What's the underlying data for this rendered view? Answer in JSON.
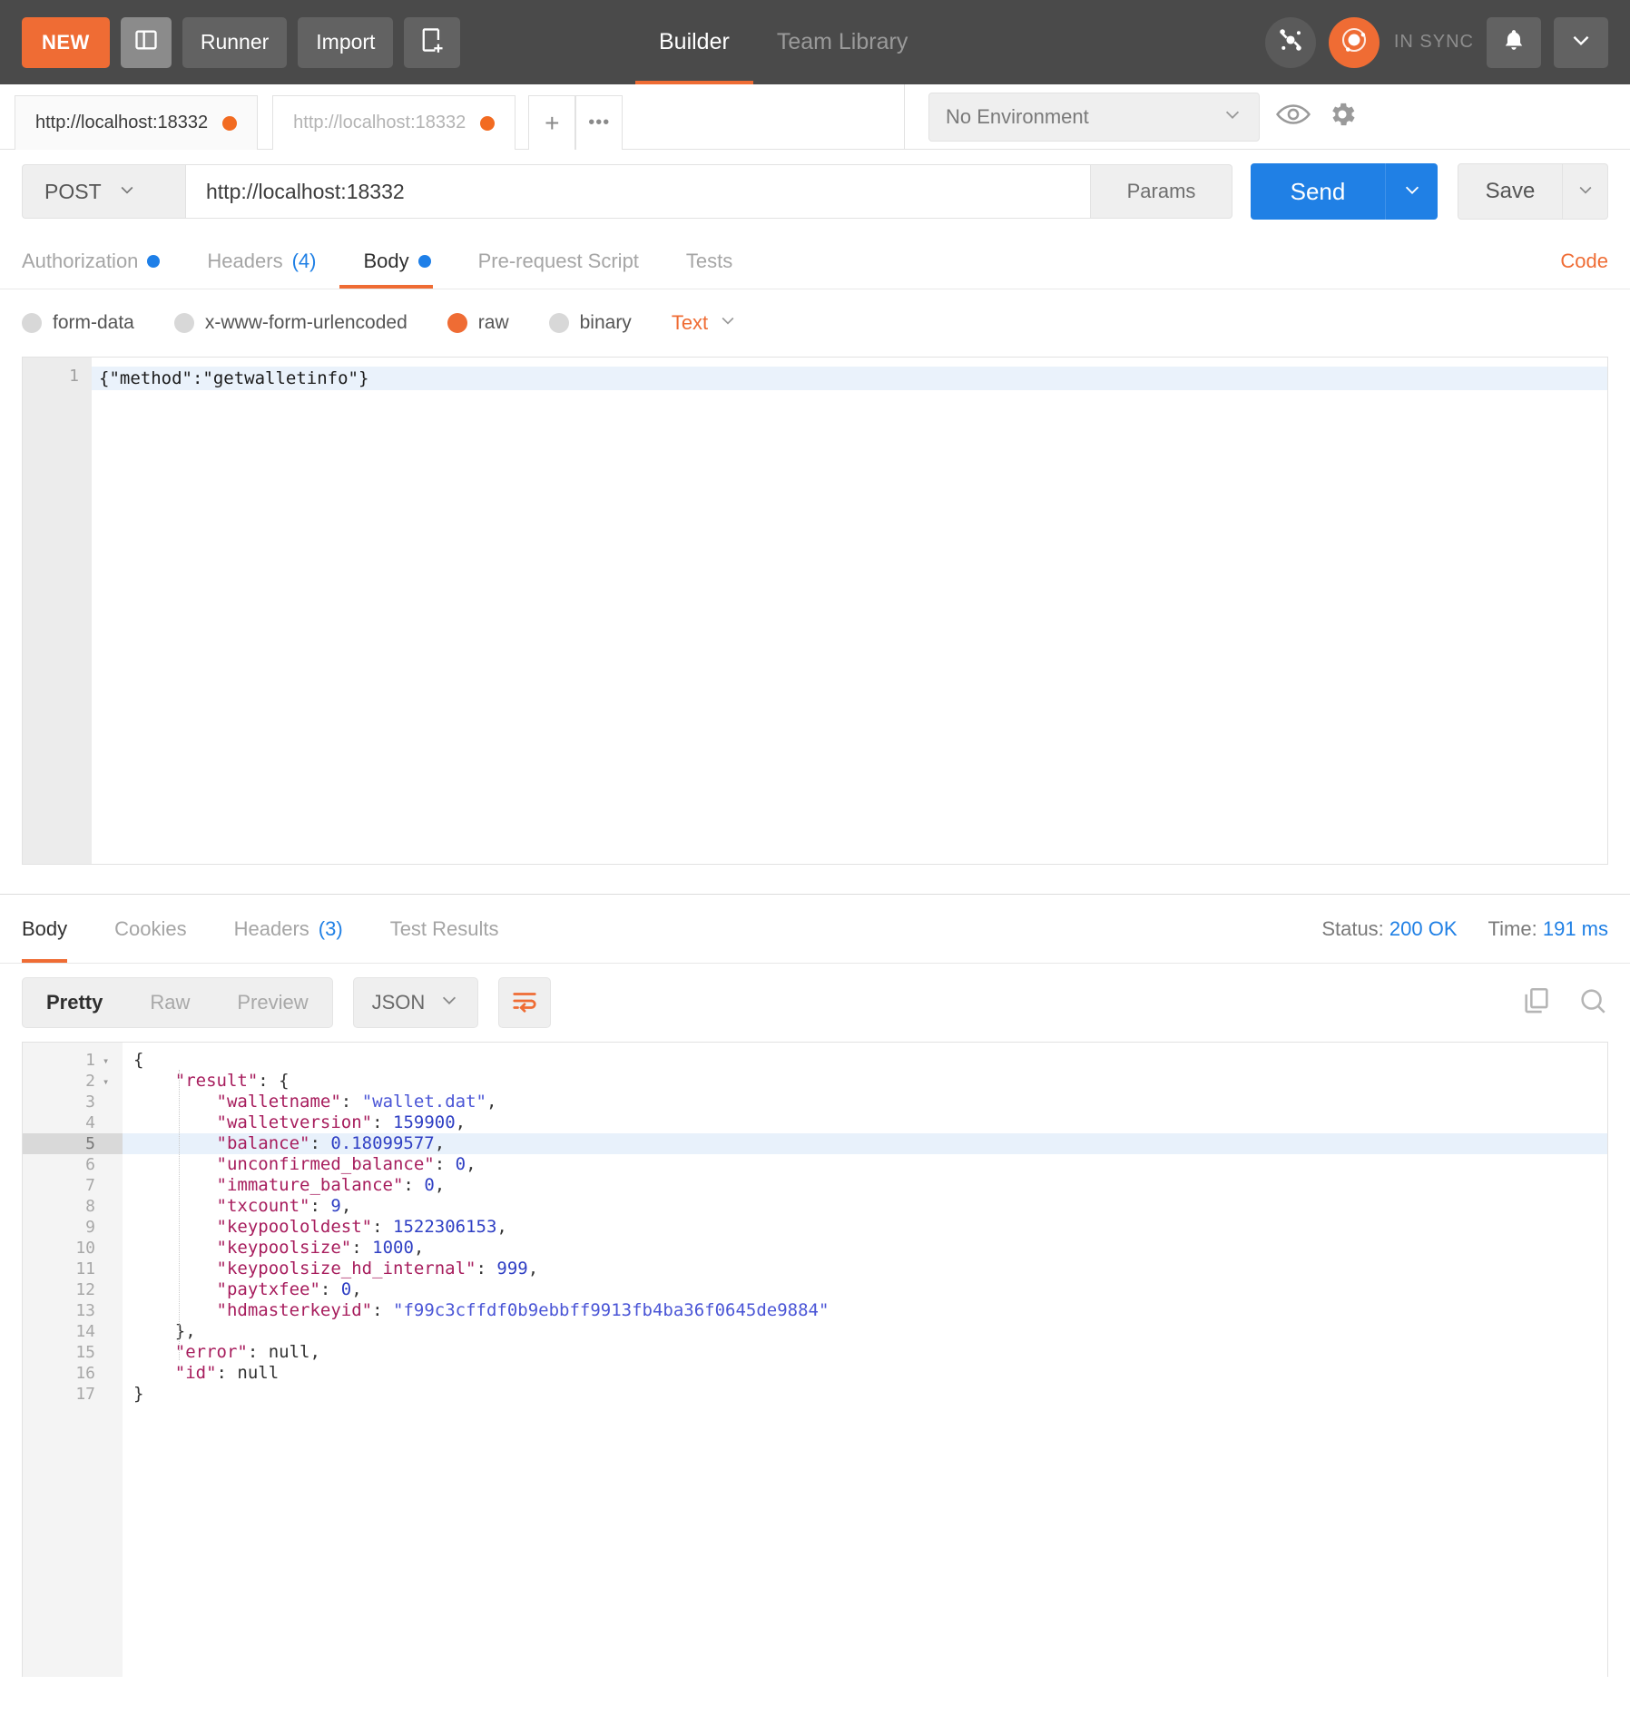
{
  "header": {
    "new_label": "NEW",
    "sidebar_icon": "sidebar-toggle-icon",
    "runner_label": "Runner",
    "import_label": "Import",
    "new_tab_icon": "new-window-icon",
    "nav_tabs": [
      {
        "label": "Builder",
        "active": true
      },
      {
        "label": "Team Library",
        "active": false
      }
    ],
    "network_icon": "network-icon",
    "sync_logo_icon": "postman-sync-icon",
    "sync_status": "IN SYNC",
    "bell_icon": "bell-icon",
    "chevron_icon": "chevron-down-icon"
  },
  "tabstrip": {
    "tabs": [
      {
        "label": "http://localhost:18332",
        "active": true,
        "unsaved": true
      },
      {
        "label": "http://localhost:18332",
        "active": false,
        "unsaved": true
      }
    ],
    "add_label": "+",
    "more_label": "•••",
    "environment": {
      "selected": "No Environment",
      "eye_icon": "eye-icon",
      "gear_icon": "gear-icon"
    }
  },
  "urlbar": {
    "method": "POST",
    "url": "http://localhost:18332",
    "params_label": "Params",
    "send_label": "Send",
    "save_label": "Save"
  },
  "request_tabs": [
    {
      "label": "Authorization",
      "badge_dot": true,
      "count": "",
      "active": false
    },
    {
      "label": "Headers",
      "badge_dot": false,
      "count": "(4)",
      "active": false
    },
    {
      "label": "Body",
      "badge_dot": true,
      "count": "",
      "active": true
    },
    {
      "label": "Pre-request Script",
      "badge_dot": false,
      "count": "",
      "active": false
    },
    {
      "label": "Tests",
      "badge_dot": false,
      "count": "",
      "active": false
    }
  ],
  "code_link": "Code",
  "body_type": {
    "options": [
      {
        "label": "form-data",
        "selected": false
      },
      {
        "label": "x-www-form-urlencoded",
        "selected": false
      },
      {
        "label": "raw",
        "selected": true
      },
      {
        "label": "binary",
        "selected": false
      }
    ],
    "format": "Text"
  },
  "request_body": {
    "line_number": "1",
    "content": "{\"method\":\"getwalletinfo\"}"
  },
  "response": {
    "tabs": [
      {
        "label": "Body",
        "count": "",
        "active": true
      },
      {
        "label": "Cookies",
        "count": "",
        "active": false
      },
      {
        "label": "Headers",
        "count": "(3)",
        "active": false
      },
      {
        "label": "Test Results",
        "count": "",
        "active": false
      }
    ],
    "status_label": "Status:",
    "status_value": "200 OK",
    "time_label": "Time:",
    "time_value": "191 ms",
    "view_modes": [
      {
        "label": "Pretty",
        "active": true
      },
      {
        "label": "Raw",
        "active": false
      },
      {
        "label": "Preview",
        "active": false
      }
    ],
    "format": "JSON",
    "wrap_icon": "word-wrap-icon",
    "copy_icon": "copy-icon",
    "search_icon": "search-icon",
    "lines": [
      {
        "n": "1",
        "fold": true,
        "highlight": false,
        "tokens": [
          {
            "t": "p",
            "v": "{"
          }
        ]
      },
      {
        "n": "2",
        "fold": true,
        "highlight": false,
        "tokens": [
          {
            "t": "p",
            "v": "    "
          },
          {
            "t": "k",
            "v": "\"result\""
          },
          {
            "t": "p",
            "v": ": {"
          }
        ]
      },
      {
        "n": "3",
        "fold": false,
        "highlight": false,
        "tokens": [
          {
            "t": "p",
            "v": "        "
          },
          {
            "t": "k",
            "v": "\"walletname\""
          },
          {
            "t": "p",
            "v": ": "
          },
          {
            "t": "s",
            "v": "\"wallet.dat\""
          },
          {
            "t": "p",
            "v": ","
          }
        ]
      },
      {
        "n": "4",
        "fold": false,
        "highlight": false,
        "tokens": [
          {
            "t": "p",
            "v": "        "
          },
          {
            "t": "k",
            "v": "\"walletversion\""
          },
          {
            "t": "p",
            "v": ": "
          },
          {
            "t": "n",
            "v": "159900"
          },
          {
            "t": "p",
            "v": ","
          }
        ]
      },
      {
        "n": "5",
        "fold": false,
        "highlight": true,
        "tokens": [
          {
            "t": "p",
            "v": "        "
          },
          {
            "t": "k",
            "v": "\"balance\""
          },
          {
            "t": "p",
            "v": ": "
          },
          {
            "t": "n",
            "v": "0.18099577"
          },
          {
            "t": "p",
            "v": ","
          }
        ]
      },
      {
        "n": "6",
        "fold": false,
        "highlight": false,
        "tokens": [
          {
            "t": "p",
            "v": "        "
          },
          {
            "t": "k",
            "v": "\"unconfirmed_balance\""
          },
          {
            "t": "p",
            "v": ": "
          },
          {
            "t": "n",
            "v": "0"
          },
          {
            "t": "p",
            "v": ","
          }
        ]
      },
      {
        "n": "7",
        "fold": false,
        "highlight": false,
        "tokens": [
          {
            "t": "p",
            "v": "        "
          },
          {
            "t": "k",
            "v": "\"immature_balance\""
          },
          {
            "t": "p",
            "v": ": "
          },
          {
            "t": "n",
            "v": "0"
          },
          {
            "t": "p",
            "v": ","
          }
        ]
      },
      {
        "n": "8",
        "fold": false,
        "highlight": false,
        "tokens": [
          {
            "t": "p",
            "v": "        "
          },
          {
            "t": "k",
            "v": "\"txcount\""
          },
          {
            "t": "p",
            "v": ": "
          },
          {
            "t": "n",
            "v": "9"
          },
          {
            "t": "p",
            "v": ","
          }
        ]
      },
      {
        "n": "9",
        "fold": false,
        "highlight": false,
        "tokens": [
          {
            "t": "p",
            "v": "        "
          },
          {
            "t": "k",
            "v": "\"keypoololdest\""
          },
          {
            "t": "p",
            "v": ": "
          },
          {
            "t": "n",
            "v": "1522306153"
          },
          {
            "t": "p",
            "v": ","
          }
        ]
      },
      {
        "n": "10",
        "fold": false,
        "highlight": false,
        "tokens": [
          {
            "t": "p",
            "v": "        "
          },
          {
            "t": "k",
            "v": "\"keypoolsize\""
          },
          {
            "t": "p",
            "v": ": "
          },
          {
            "t": "n",
            "v": "1000"
          },
          {
            "t": "p",
            "v": ","
          }
        ]
      },
      {
        "n": "11",
        "fold": false,
        "highlight": false,
        "tokens": [
          {
            "t": "p",
            "v": "        "
          },
          {
            "t": "k",
            "v": "\"keypoolsize_hd_internal\""
          },
          {
            "t": "p",
            "v": ": "
          },
          {
            "t": "n",
            "v": "999"
          },
          {
            "t": "p",
            "v": ","
          }
        ]
      },
      {
        "n": "12",
        "fold": false,
        "highlight": false,
        "tokens": [
          {
            "t": "p",
            "v": "        "
          },
          {
            "t": "k",
            "v": "\"paytxfee\""
          },
          {
            "t": "p",
            "v": ": "
          },
          {
            "t": "n",
            "v": "0"
          },
          {
            "t": "p",
            "v": ","
          }
        ]
      },
      {
        "n": "13",
        "fold": false,
        "highlight": false,
        "tokens": [
          {
            "t": "p",
            "v": "        "
          },
          {
            "t": "k",
            "v": "\"hdmasterkeyid\""
          },
          {
            "t": "p",
            "v": ": "
          },
          {
            "t": "s",
            "v": "\"f99c3cffdf0b9ebbff9913fb4ba36f0645de9884\""
          }
        ]
      },
      {
        "n": "14",
        "fold": false,
        "highlight": false,
        "tokens": [
          {
            "t": "p",
            "v": "    },"
          }
        ]
      },
      {
        "n": "15",
        "fold": false,
        "highlight": false,
        "tokens": [
          {
            "t": "p",
            "v": "    "
          },
          {
            "t": "k",
            "v": "\"error\""
          },
          {
            "t": "p",
            "v": ": "
          },
          {
            "t": "nul",
            "v": "null"
          },
          {
            "t": "p",
            "v": ","
          }
        ]
      },
      {
        "n": "16",
        "fold": false,
        "highlight": false,
        "tokens": [
          {
            "t": "p",
            "v": "    "
          },
          {
            "t": "k",
            "v": "\"id\""
          },
          {
            "t": "p",
            "v": ": "
          },
          {
            "t": "nul",
            "v": "null"
          }
        ]
      },
      {
        "n": "17",
        "fold": false,
        "highlight": false,
        "tokens": [
          {
            "t": "p",
            "v": "}"
          }
        ]
      }
    ]
  },
  "colors": {
    "accent_orange": "#ef6c34",
    "blue": "#2080e5",
    "header_bg": "#4a4a4a"
  }
}
